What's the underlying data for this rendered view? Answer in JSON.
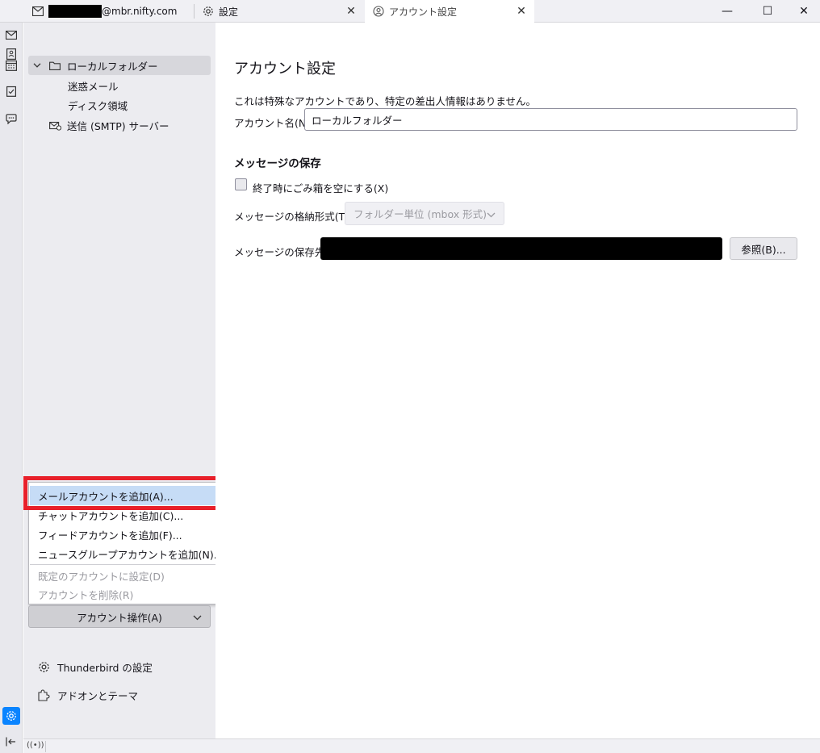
{
  "tabs": [
    {
      "label_suffix": "@mbr.nifty.com",
      "icon": "mail-icon"
    },
    {
      "label": "設定",
      "icon": "gear-icon"
    },
    {
      "label": "アカウント設定",
      "icon": "account-icon"
    }
  ],
  "window_controls": {
    "minimize": "—",
    "maximize": "☐",
    "close": "✕"
  },
  "tree": {
    "local_folder": "ローカルフォルダー",
    "junk": "迷惑メール",
    "disk_space": "ディスク領域",
    "smtp": "送信 (SMTP) サーバー"
  },
  "menu": {
    "add_mail": "メールアカウントを追加(A)...",
    "add_chat": "チャットアカウントを追加(C)...",
    "add_feed": "フィードアカウントを追加(F)...",
    "add_newsgroup": "ニュースグループアカウントを追加(N)...",
    "set_default": "既定のアカウントに設定(D)",
    "delete_account": "アカウントを削除(R)"
  },
  "account_actions": "アカウント操作(A)",
  "thunderbird_settings": "Thunderbird の設定",
  "addons_themes": "アドオンとテーマ",
  "main": {
    "title": "アカウント設定",
    "description": "これは特殊なアカウントであり、特定の差出人情報はありません。",
    "account_name_label": "アカウント名(N):",
    "account_name_value": "ローカルフォルダー",
    "message_storage_heading": "メッセージの保存",
    "empty_trash_label": "終了時にごみ箱を空にする(X)",
    "store_format_label": "メッセージの格納形式(T):",
    "store_format_value": "フォルダー単位 (mbox 形式)",
    "store_path_label": "メッセージの保存先:",
    "browse_button": "参照(B)..."
  },
  "status": {
    "icon_text": "((•))"
  },
  "colors": {
    "accent": "#0a84ff",
    "highlight_box": "#e8202a",
    "menu_hover": "#c6dcf6"
  }
}
